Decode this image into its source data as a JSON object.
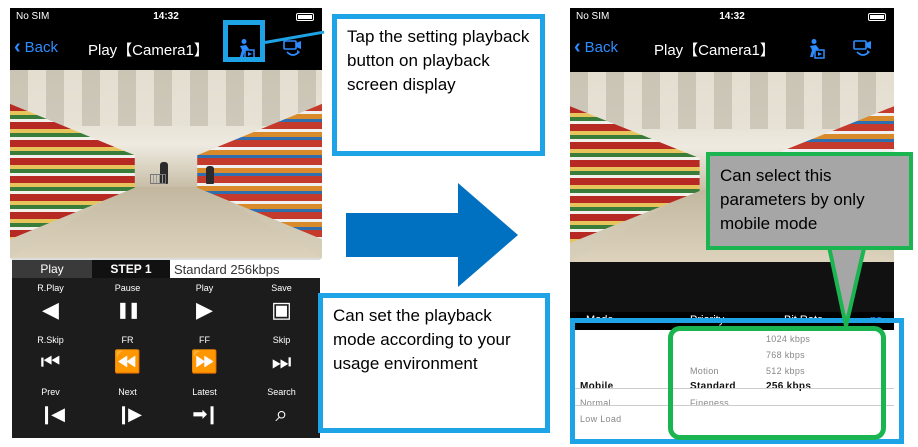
{
  "left_phone": {
    "status": {
      "carrier": "No SIM",
      "time": "14:32"
    },
    "nav": {
      "back_label": "Back",
      "title": "Play【Camera1】"
    },
    "tabs": {
      "play": "Play",
      "step": "STEP 1",
      "quality": "Standard 256kbps"
    },
    "controls": [
      {
        "label": "R.Play",
        "icon": "reverse-play-icon"
      },
      {
        "label": "Pause",
        "icon": "pause-icon"
      },
      {
        "label": "Play",
        "icon": "play-icon"
      },
      {
        "label": "Save",
        "icon": "camera-icon"
      },
      {
        "label": "R.Skip",
        "icon": "skip-back-icon"
      },
      {
        "label": "FR",
        "icon": "fast-rewind-icon"
      },
      {
        "label": "FF",
        "icon": "fast-forward-icon"
      },
      {
        "label": "Skip",
        "icon": "skip-forward-icon"
      },
      {
        "label": "Prev",
        "icon": "previous-frame-icon"
      },
      {
        "label": "Next",
        "icon": "next-frame-icon"
      },
      {
        "label": "Latest",
        "icon": "latest-icon"
      },
      {
        "label": "Search",
        "icon": "search-icon"
      }
    ]
  },
  "right_phone": {
    "status": {
      "carrier": "No SIM",
      "time": "14:32"
    },
    "nav": {
      "back_label": "Back",
      "title": "Play【Camera1】"
    },
    "header": {
      "mode": "Mode",
      "priority": "Priority",
      "bitrate": "Bit Rate",
      "done": "ne"
    },
    "mode_options": [
      "Mobile",
      "Normal",
      "Low Load"
    ],
    "priority_options": [
      "Motion",
      "Standard",
      "Fineness"
    ],
    "bitrate_options": [
      "1024 kbps",
      "768 kbps",
      "512 kbps",
      "256 kbps"
    ],
    "selected": {
      "mode": "Mobile",
      "priority": "Standard",
      "bitrate": "256 kbps"
    }
  },
  "callouts": {
    "setting_button": "Tap the setting playback button on playback screen display",
    "playback_mode": "Can set the playback mode according to your usage environment",
    "mobile_only": "Can select this parameters by only mobile mode"
  },
  "colors": {
    "highlight_blue": "#1da3e6",
    "highlight_green": "#1ab551",
    "arrow": "#0070c0",
    "callout_gray": "#a6a6a6",
    "ios_blue": "#2d8cff"
  }
}
